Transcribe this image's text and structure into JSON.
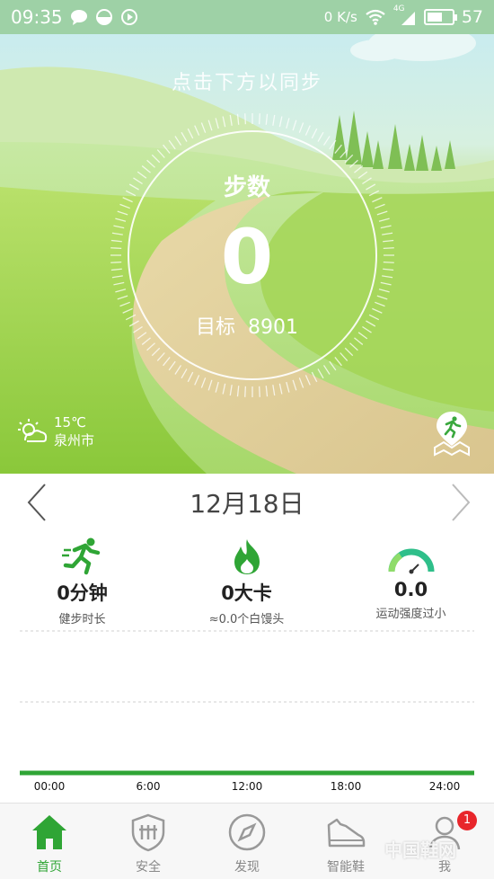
{
  "status_bar": {
    "time": "09:35",
    "network_speed": "0 K/s",
    "signal_label": "4G",
    "battery": "57"
  },
  "hero": {
    "sync_hint": "点击下方以同步",
    "steps_title": "步数",
    "steps_value": "0",
    "goal_label": "目标",
    "goal_value": "8901",
    "weather": {
      "temperature": "15℃",
      "city": "泉州市",
      "icon": "partly-cloudy-icon"
    },
    "route_icon": "runner-pin-icon"
  },
  "date_nav": {
    "date": "12月18日",
    "prev_icon": "chevron-left-icon",
    "next_icon": "chevron-right-icon"
  },
  "stats": [
    {
      "icon": "runner-icon",
      "value": "0分钟",
      "label": "健步时长"
    },
    {
      "icon": "flame-icon",
      "value": "0大卡",
      "label": "≈0.0个白馒头"
    },
    {
      "icon": "gauge-icon",
      "value": "0.0",
      "label": "运动强度过小"
    }
  ],
  "chart_data": {
    "type": "bar",
    "x": [
      "00:00",
      "6:00",
      "12:00",
      "18:00",
      "24:00"
    ],
    "values": [
      0,
      0,
      0,
      0,
      0
    ],
    "grid": true
  },
  "bottom_nav": [
    {
      "label": "首页",
      "icon": "home-icon",
      "active": true
    },
    {
      "label": "安全",
      "icon": "shield-icon",
      "active": false
    },
    {
      "label": "发现",
      "icon": "compass-icon",
      "active": false
    },
    {
      "label": "智能鞋",
      "icon": "shoe-icon",
      "active": false
    },
    {
      "label": "我",
      "icon": "profile-icon",
      "active": false,
      "badge": "1"
    }
  ],
  "watermark": "中国鞋网",
  "colors": {
    "accent_green": "#2fa535",
    "badge_red": "#e8262b"
  }
}
